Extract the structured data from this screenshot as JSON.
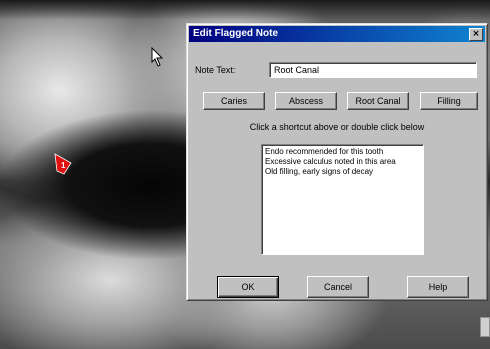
{
  "dialog": {
    "title": "Edit Flagged Note",
    "close_glyph": "×",
    "note_text_label": "Note Text:",
    "note_text_value": "Root Canal",
    "quick_buttons": {
      "caries": "Caries",
      "abscess": "Abscess",
      "root_canal": "Root Canal",
      "filling": "Filling"
    },
    "hint": "Click a shortcut above or double click below",
    "notes_list": [
      "Endo recommended for this tooth",
      "Excessive calculus noted in this area",
      "Old filling, early signs of decay"
    ],
    "ok_label": "OK",
    "cancel_label": "Cancel",
    "help_label": "Help"
  },
  "marker": {
    "number": "1",
    "color": "#e01010"
  },
  "icons": {
    "cursor": "pointer-cursor-icon",
    "tooth_marker": "tooth-flag-icon",
    "close": "close-icon"
  }
}
